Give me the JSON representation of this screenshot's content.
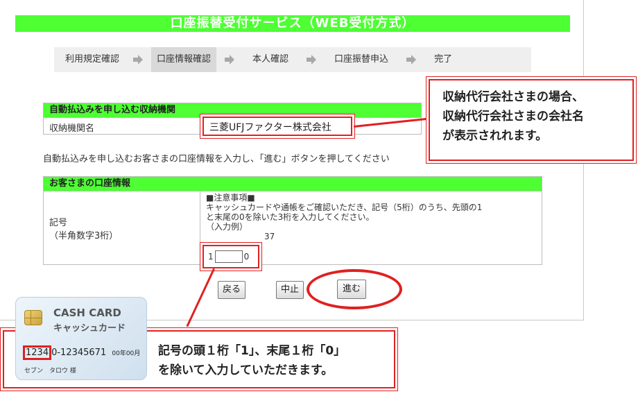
{
  "header": {
    "title": "口座振替受付サービス（WEB受付方式）"
  },
  "steps": [
    {
      "label": "利用規定確認",
      "active": false
    },
    {
      "label": "口座情報確認",
      "active": true
    },
    {
      "label": "本人確認",
      "active": false
    },
    {
      "label": "口座振替申込",
      "active": false
    },
    {
      "label": "完了",
      "active": false
    }
  ],
  "institution": {
    "section_title": "自動払込みを申し込む収納機関",
    "label": "収納機関名",
    "value": "三菱UFJファクター株式会社"
  },
  "instruction": "自動払込みを申し込むお客さまの口座情報を入力し、「進む」ボタンを押してください",
  "account": {
    "section_title": "お客さまの口座情報",
    "label_line1": "記号",
    "label_line2": "（半角数字3桁）",
    "note_title": "■注意事項■",
    "note_line1": "キャッシュカードや通帳をご確認いただき、記号（5桁）のうち、先頭の1",
    "note_line2": "と末尾の0を除いた3桁を入力してください。",
    "example_label": "（入力例）",
    "example_partial": "37",
    "prefix": "1",
    "suffix": "0",
    "input_value": ""
  },
  "buttons": {
    "back": "戻る",
    "cancel": "中止",
    "next": "進む"
  },
  "callouts": {
    "top_line1": "収納代行会社さまの場合、",
    "top_line2": "収納代行会社さまの会社名",
    "top_line3": "が表示されれます。",
    "bottom_line1": "記号の頭１桁「1」、末尾１桁「0」",
    "bottom_line2": "を除いて入力していただきます。"
  },
  "card": {
    "title_en": "CASH CARD",
    "title_jp": "キャッシュカード",
    "number_highlight": "1234",
    "number_rest": "0-12345671",
    "expiry": "00年00月",
    "holder": "セブン　タロウ 様"
  },
  "colors": {
    "accent_green": "#4dff33",
    "callout_red": "#e02020"
  }
}
